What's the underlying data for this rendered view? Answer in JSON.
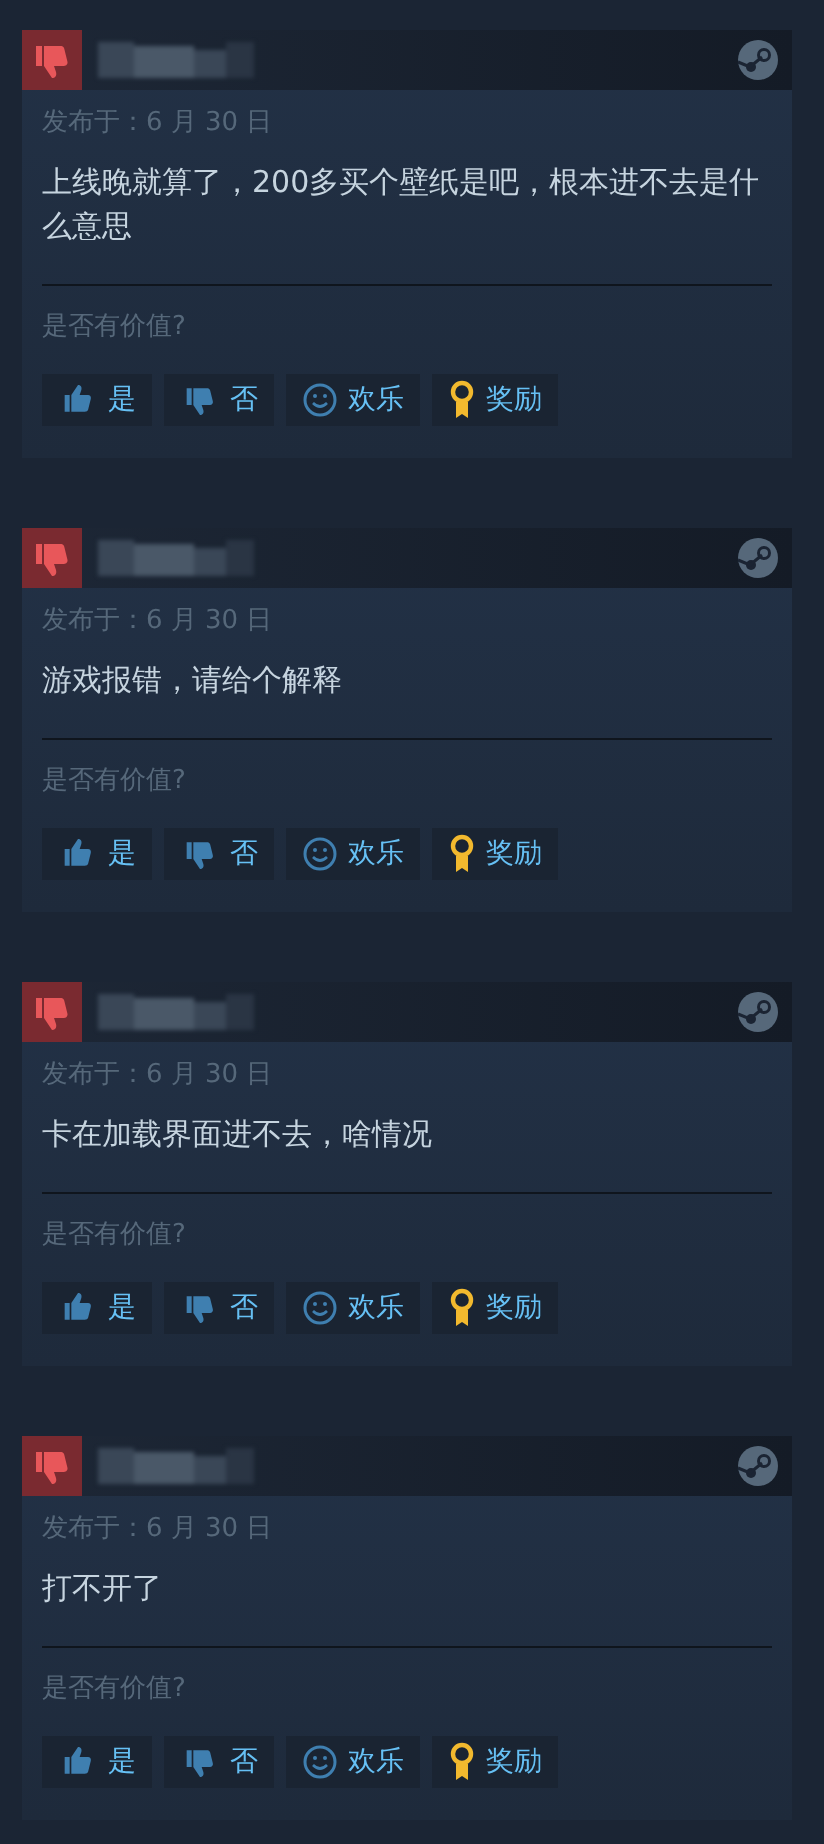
{
  "reviews": [
    {
      "recommended": false,
      "posted": "发布于：6 月 30 日",
      "text": "上线晚就算了，200多买个壁纸是吧，根本进不去是什么意思",
      "helpful_prompt": "是否有价值?",
      "buttons": [
        {
          "kind": "yes",
          "label": "是"
        },
        {
          "kind": "no",
          "label": "否"
        },
        {
          "kind": "funny",
          "label": "欢乐"
        },
        {
          "kind": "award",
          "label": "奖励"
        }
      ]
    },
    {
      "recommended": false,
      "posted": "发布于：6 月 30 日",
      "text": "游戏报错，请给个解释",
      "helpful_prompt": "是否有价值?",
      "buttons": [
        {
          "kind": "yes",
          "label": "是"
        },
        {
          "kind": "no",
          "label": "否"
        },
        {
          "kind": "funny",
          "label": "欢乐"
        },
        {
          "kind": "award",
          "label": "奖励"
        }
      ]
    },
    {
      "recommended": false,
      "posted": "发布于：6 月 30 日",
      "text": "卡在加载界面进不去，啥情况",
      "helpful_prompt": "是否有价值?",
      "buttons": [
        {
          "kind": "yes",
          "label": "是"
        },
        {
          "kind": "no",
          "label": "否"
        },
        {
          "kind": "funny",
          "label": "欢乐"
        },
        {
          "kind": "award",
          "label": "奖励"
        }
      ]
    },
    {
      "recommended": false,
      "posted": "发布于：6 月 30 日",
      "text": "打不开了",
      "helpful_prompt": "是否有价值?",
      "buttons": [
        {
          "kind": "yes",
          "label": "是"
        },
        {
          "kind": "no",
          "label": "否"
        },
        {
          "kind": "funny",
          "label": "欢乐"
        },
        {
          "kind": "award",
          "label": "奖励"
        }
      ]
    }
  ]
}
